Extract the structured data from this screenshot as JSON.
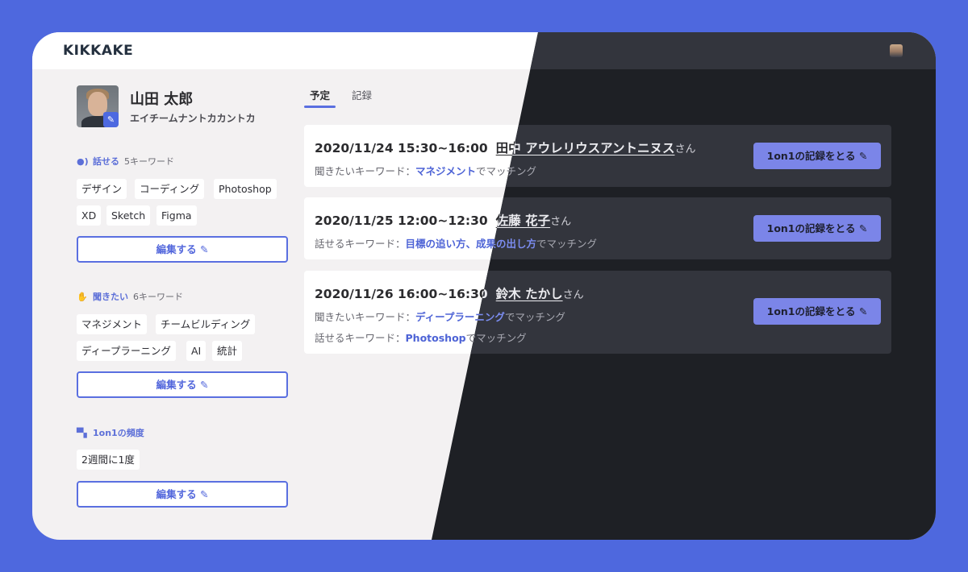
{
  "app": {
    "logo": "KIKKAKE"
  },
  "profile": {
    "name": "山田 太郎",
    "kana": "エイチームナントカカントカ"
  },
  "sections": {
    "speak": {
      "label": "話せる",
      "count": "5キーワード",
      "keywords": [
        "デザイン",
        "コーディング",
        "Photoshop",
        "XD",
        "Sketch",
        "Figma"
      ],
      "edit_label": "編集する"
    },
    "listen": {
      "label": "聞きたい",
      "count": "6キーワード",
      "keywords": [
        "マネジメント",
        "チームビルディング",
        "ディープラーニング",
        "AI",
        "統計"
      ],
      "edit_label": "編集する"
    },
    "frequency": {
      "label": "1on1の頻度",
      "value": "2週間に1度",
      "edit_label": "編集する"
    }
  },
  "tabs": [
    {
      "label": "予定",
      "active": true
    },
    {
      "label": "記録",
      "active": false
    }
  ],
  "meetings": [
    {
      "datetime": "2020/11/24 15:30~16:00",
      "person": "田中 アウレリウスアントニヌス",
      "honorific": "さん",
      "lines": [
        {
          "prefix": "聞きたいキーワード：",
          "keyword": "マネジメント",
          "suffix": "でマッチング"
        }
      ],
      "button": "1on1の記録をとる"
    },
    {
      "datetime": "2020/11/25 12:00~12:30",
      "person": "佐藤 花子",
      "honorific": "さん",
      "lines": [
        {
          "prefix": "話せるキーワード：",
          "keyword": "目標の追い方、成果の出し方",
          "suffix": "でマッチング"
        }
      ],
      "button": "1on1の記録をとる"
    },
    {
      "datetime": "2020/11/26 16:00~16:30",
      "person": "鈴木 たかし",
      "honorific": "さん",
      "lines": [
        {
          "prefix": "聞きたいキーワード：",
          "keyword": "ディープラーニング",
          "suffix": "でマッチング"
        },
        {
          "prefix": "話せるキーワード：",
          "keyword": "Photoshop",
          "suffix": "でマッチング"
        }
      ],
      "button": "1on1の記録をとる"
    }
  ],
  "icons": {
    "speak": "person-speaking-icon",
    "listen": "raised-hand-icon",
    "frequency": "chat-bubbles-icon",
    "edit": "pencil-icon"
  },
  "colors": {
    "background": "#4e68de",
    "accent": "#5a6fe0",
    "button": "#7b85e8",
    "light_surface": "#f3f1f2",
    "dark_surface": "#1e2025",
    "dark_card": "#33353d"
  }
}
